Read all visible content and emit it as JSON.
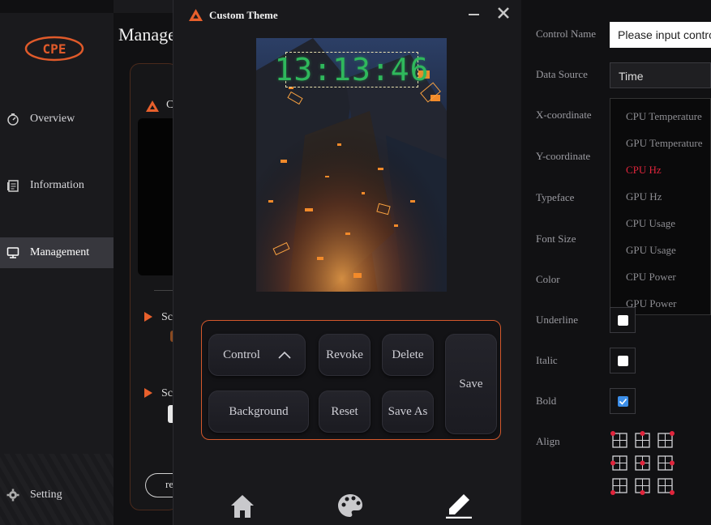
{
  "sidebar": {
    "logo_text": "CPE",
    "items": [
      {
        "label": "Overview",
        "icon": "gauge-icon"
      },
      {
        "label": "Information",
        "icon": "document-icon"
      },
      {
        "label": "Management",
        "icon": "monitor-icon",
        "active": true
      }
    ],
    "setting_label": "Setting"
  },
  "behind": {
    "title": "Manage",
    "card_letter": "C",
    "section1": "Sc",
    "section2": "Sc",
    "button_label": "re"
  },
  "dialog": {
    "title": "Custom Theme",
    "clock": "13:13:46",
    "buttons": {
      "control": "Control",
      "revoke": "Revoke",
      "delete": "Delete",
      "save": "Save",
      "background": "Background",
      "reset": "Reset",
      "save_as": "Save As"
    },
    "bottom_nav": [
      "home-icon",
      "palette-icon",
      "pen-icon"
    ]
  },
  "properties": {
    "control_name_label": "Control Name",
    "control_name_placeholder": "Please input control name",
    "data_source_label": "Data Source",
    "data_source_value": "Time",
    "x_label": "X-coordinate",
    "y_label": "Y-coordinate",
    "typeface_label": "Typeface",
    "font_size_label": "Font Size",
    "color_label": "Color",
    "underline_label": "Underline",
    "italic_label": "Italic",
    "bold_label": "Bold",
    "align_label": "Align",
    "underline": false,
    "italic": false,
    "bold": true,
    "dropdown_options": [
      "CPU Temperature",
      "GPU Temperature",
      "CPU Hz",
      "GPU Hz",
      "CPU Usage",
      "GPU Usage",
      "CPU Power",
      "GPU Power"
    ],
    "dropdown_selected": "CPU Hz"
  },
  "colors": {
    "accent": "#e8602c",
    "selected": "#e0253c",
    "clock": "#2fb85c",
    "checkbox_checked": "#3c8ee8"
  }
}
